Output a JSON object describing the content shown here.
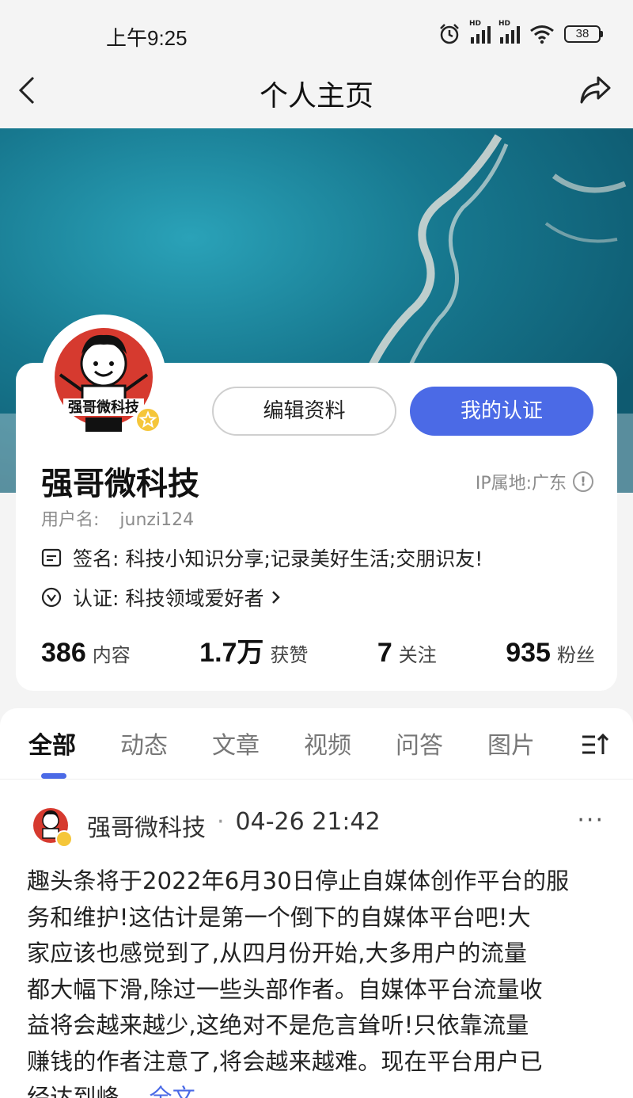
{
  "status_bar": {
    "time": "上午9:25",
    "battery": "38",
    "hd1": "HD",
    "hd2": "HD"
  },
  "nav": {
    "title": "个人主页"
  },
  "profile": {
    "avatar_text": "强哥微科技",
    "edit_button": "编辑资料",
    "cert_button": "我的认证",
    "name": "强哥微科技",
    "ip_location": "IP属地:广东",
    "username_label": "用户名:",
    "username": "junzi124",
    "signature_label": "签名:",
    "signature": "科技小知识分享;记录美好生活;交朋识友!",
    "cert_label": "认证:",
    "cert_value": "科技领域爱好者"
  },
  "stats": [
    {
      "value": "386",
      "label": "内容"
    },
    {
      "value": "1.7万",
      "label": "获赞"
    },
    {
      "value": "7",
      "label": "关注"
    },
    {
      "value": "935",
      "label": "粉丝"
    }
  ],
  "tabs": [
    {
      "label": "全部",
      "active": true
    },
    {
      "label": "动态"
    },
    {
      "label": "文章"
    },
    {
      "label": "视频"
    },
    {
      "label": "问答"
    },
    {
      "label": "图片"
    }
  ],
  "post": {
    "author": "强哥微科技",
    "separator": "·",
    "time": "04-26 21:42",
    "more": "···",
    "body_lines": [
      "趣头条将于2022年6月30日停止自媒体创作平台的服",
      "务和维护!这估计是第一个倒下的自媒体平台吧!大",
      "家应该也感觉到了,从四月份开始,大多用户的流量",
      "都大幅下滑,除过一些头部作者。自媒体平台流量收",
      "益将会越来越少,这绝对不是危言耸听!只依靠流量",
      "赚钱的作者注意了,将会越来越难。现在平台用户已",
      "经达到峰"
    ],
    "ellipsis": "...",
    "full_text_link": "全文"
  },
  "colors": {
    "accent": "#4b6ae6",
    "badge": "#f5c63a",
    "ocean": "#1a7e96"
  }
}
